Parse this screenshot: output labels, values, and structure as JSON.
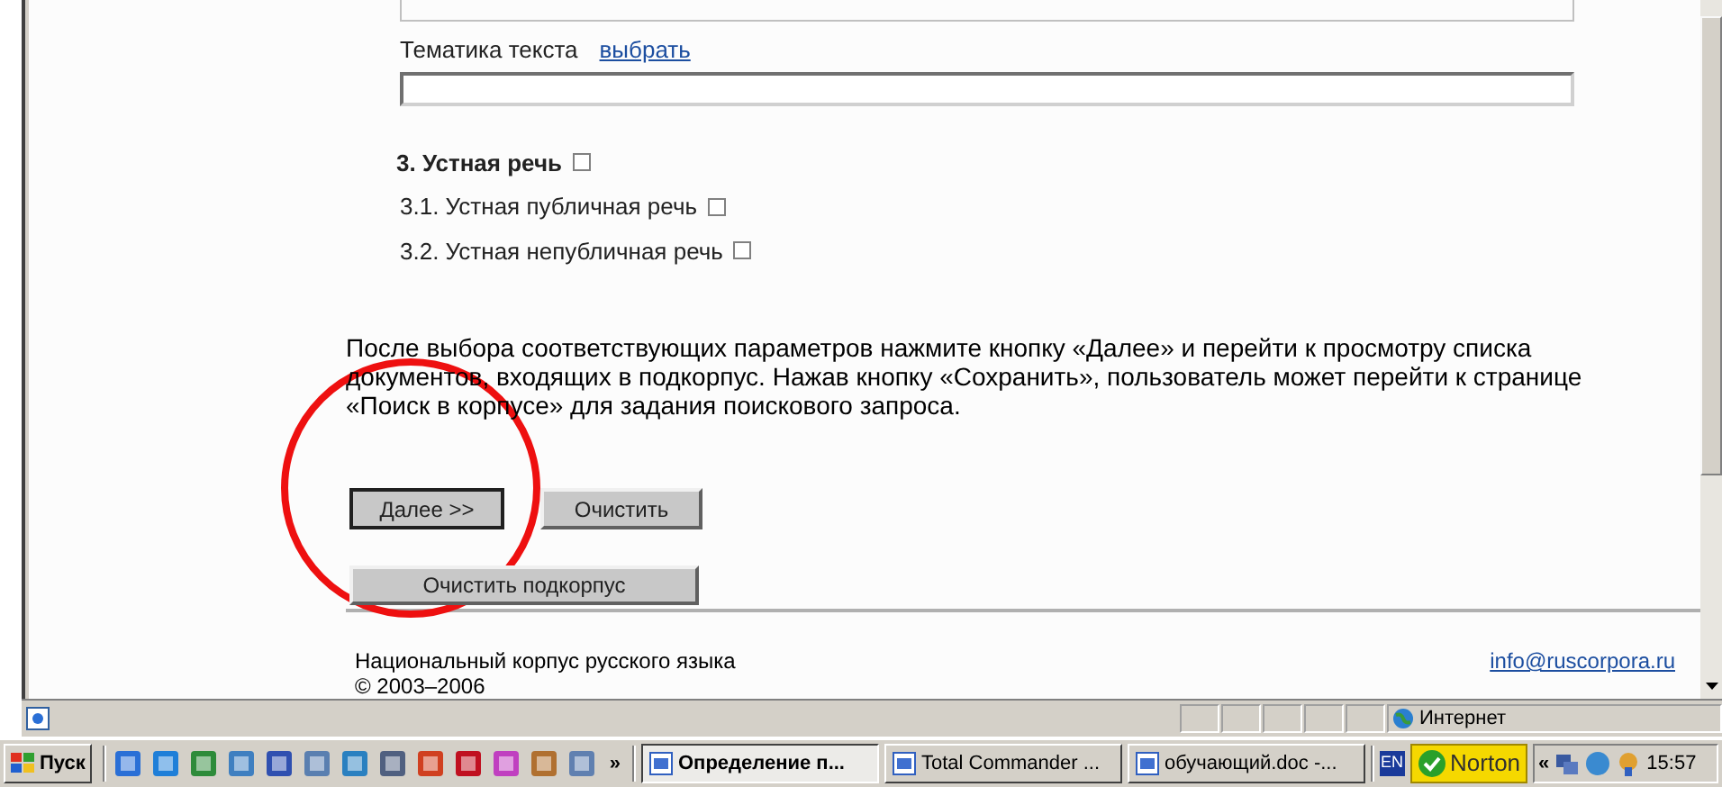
{
  "topic": {
    "label": "Тематика текста",
    "link": "выбрать"
  },
  "section": {
    "title": "3. Устная речь",
    "checked": false
  },
  "subsections": [
    {
      "label": "3.1. Устная публичная речь",
      "checked": false
    },
    {
      "label": "3.2. Устная непубличная речь",
      "checked": false
    }
  ],
  "instructions": "После выбора соответствующих параметров нажмите кнопку «Далее» и перейти к просмотру списка документов, входящих в подкорпус. Нажав кнопку «Сохранить», пользователь может перейти к странице «Поиск в корпусе» для задания поискового запроса.",
  "buttons": [
    {
      "label": "Далее >>",
      "selected": true
    },
    {
      "label": "Очистить",
      "selected": false
    }
  ],
  "clear_button": "Очистить подкорпус",
  "footer": {
    "name": "Национальный корпус русского языка",
    "years": "© 2003–2006",
    "email": "info@ruscorpora.ru"
  },
  "status_bar": {
    "zone": "Интернет"
  },
  "taskbar": {
    "start": "Пуск",
    "more": "»",
    "tasks": [
      {
        "label": "Определение п...",
        "selected": true
      },
      {
        "label": "Total Commander ...",
        "selected": false
      },
      {
        "label": "обучающий.doc -...",
        "selected": false
      }
    ],
    "language": "EN",
    "norton": "Norton",
    "tray_toggle": "«",
    "clock": "15:57"
  }
}
